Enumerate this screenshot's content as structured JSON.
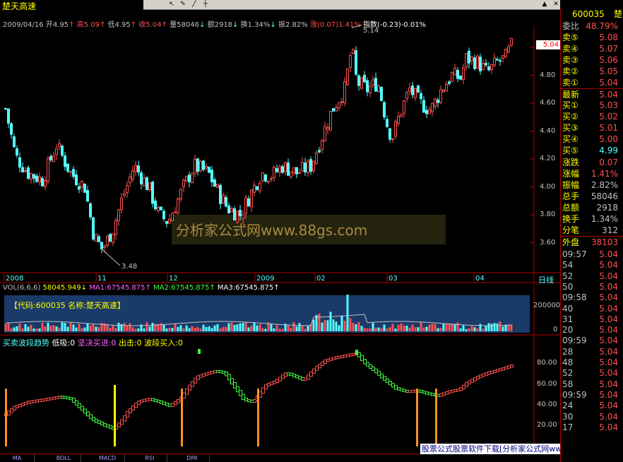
{
  "stock": {
    "name": "楚天高速",
    "code": "600035"
  },
  "header": {
    "date": "2009/04/16",
    "open_label": "开",
    "open": "4.95",
    "high_label": "高",
    "high": "5.09",
    "low_label": "低",
    "low": "4.95",
    "close_label": "收",
    "close": "5.04",
    "vol_label": "量",
    "vol": "58046",
    "amount_label": "额",
    "amount": "2918",
    "turnover_label": "换",
    "turnover": "1.34%",
    "amplitude_label": "振",
    "amplitude": "2.82%",
    "change_label": "涨",
    "change": "(0.07)",
    "change_pct": "1.41%",
    "index_label": "指数",
    "index_change": "(-0.23)",
    "index_pct": "-0.01%"
  },
  "price_axis": {
    "ticks": [
      "5.00",
      "4.80",
      "4.60",
      "4.40",
      "4.20",
      "4.00",
      "3.80",
      "3.60"
    ],
    "current": "5.04"
  },
  "annotations": {
    "high": "5.14",
    "low": "3.48"
  },
  "watermark": "分析家公式网www.88gs.com",
  "time_axis": [
    "2008",
    "11",
    "12",
    "2009",
    "02",
    "03",
    "04"
  ],
  "period_label": "日线",
  "vol_panel": {
    "title": "VOL(6,6,6)",
    "vol_value": "58045.949",
    "ma1": "MA1:67545.875",
    "ma2": "MA2:67545.875",
    "ma3": "MA3:67545.875",
    "code_box": "【代码:600035  名称:楚天高速】",
    "axis": [
      "200000",
      "0"
    ]
  },
  "ind_panel": {
    "title": "买卖波段趋势",
    "low_buy": "低吸:0",
    "firm_buy": "坚决买进:0",
    "sell": "出击:0",
    "wave_buy": "波段买入:0",
    "axis": [
      "80.00",
      "60.00",
      "40.00",
      "20.00"
    ]
  },
  "bottom_tabs": [
    "MA",
    "BOLL",
    "MACD",
    "RSI",
    "DMI"
  ],
  "ad_text": "股票公式股票软件下载[分析家公式网www.88gs.com]",
  "right": {
    "code": "600035",
    "name": "楚",
    "weibi_label": "委比",
    "weibi": "48.79%",
    "asks": [
      {
        "label": "卖⑤",
        "price": "5.08"
      },
      {
        "label": "卖④",
        "price": "5.07"
      },
      {
        "label": "卖③",
        "price": "5.06"
      },
      {
        "label": "卖②",
        "price": "5.05"
      },
      {
        "label": "卖①",
        "price": "5.04"
      }
    ],
    "latest_label": "最新",
    "latest": "5.04",
    "bids": [
      {
        "label": "买①",
        "price": "5.03"
      },
      {
        "label": "买②",
        "price": "5.02"
      },
      {
        "label": "买③",
        "price": "5.01"
      },
      {
        "label": "买④",
        "price": "5.00"
      },
      {
        "label": "买⑤",
        "price": "4.99"
      }
    ],
    "stats": [
      {
        "label": "涨跌",
        "value": "0.07"
      },
      {
        "label": "涨幅",
        "value": "1.41%"
      },
      {
        "label": "振幅",
        "value": "2.82%"
      },
      {
        "label": "总手",
        "value": "58046"
      },
      {
        "label": "总额",
        "value": "2918"
      },
      {
        "label": "换手",
        "value": "1.34%"
      },
      {
        "label": "分笔",
        "value": "312"
      }
    ],
    "outer_label": "外盘",
    "outer": "38103",
    "ticks": [
      {
        "time": "09:57",
        "price": "5.04"
      },
      {
        "time": "54",
        "price": "5.04"
      },
      {
        "time": "52",
        "price": "5.04"
      },
      {
        "time": "50",
        "price": "5.04"
      },
      {
        "time": "09:58",
        "price": "5.04"
      },
      {
        "time": "40",
        "price": "5.04"
      },
      {
        "time": "31",
        "price": "5.04"
      },
      {
        "time": "20",
        "price": "5.04"
      },
      {
        "time": "09:59",
        "price": "5.04"
      },
      {
        "time": "28",
        "price": "5.04"
      },
      {
        "time": "48",
        "price": "5.04"
      },
      {
        "time": "52",
        "price": "5.04"
      },
      {
        "time": "58",
        "price": "5.04"
      },
      {
        "time": "09:59",
        "price": "5.04"
      },
      {
        "time": "24",
        "price": "5.04"
      },
      {
        "time": "30",
        "price": "5.04"
      },
      {
        "time": "17",
        "price": "5.04"
      }
    ]
  },
  "colors": {
    "up": "#ff5050",
    "down": "#54ffff",
    "bg": "#000000",
    "border": "#b00000",
    "yellow": "#ffff00",
    "blue_panel": "#1a3a6a",
    "green_ind": "#40ff40",
    "orange": "#ff9020"
  },
  "chart_data": {
    "type": "candlestick",
    "x": "trading days 2008-10 to 2009-04-16",
    "price": {
      "ylim": [
        3.48,
        5.14
      ],
      "ohlc_first_last": [
        {
          "label": "2009-04-16",
          "open": 4.95,
          "high": 5.09,
          "low": 4.95,
          "close": 5.04
        }
      ]
    },
    "indicator": {
      "ylim": [
        0,
        100
      ]
    }
  }
}
